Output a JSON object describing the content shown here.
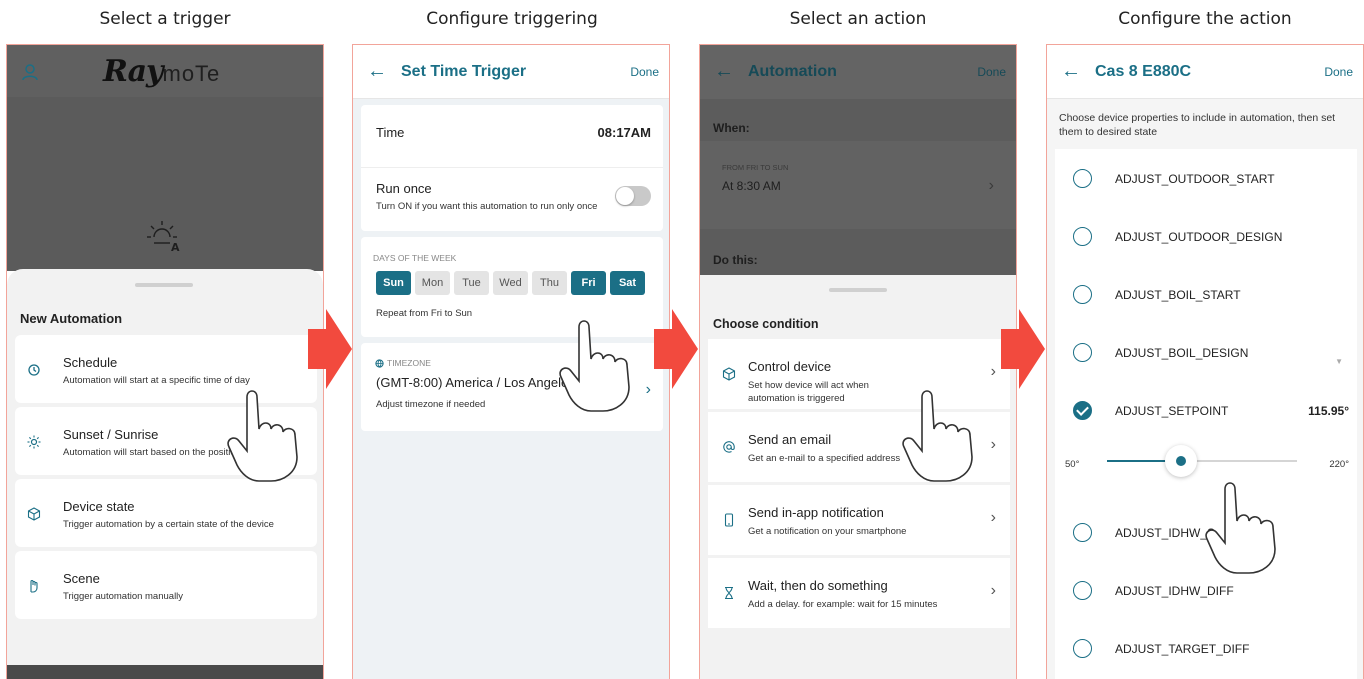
{
  "steps": {
    "s1": "Select a trigger",
    "s2": "Configure triggering",
    "s3": "Select an action",
    "s4": "Configure the action"
  },
  "colors": {
    "accent": "#1b6f86",
    "arrow": "#f24a3e",
    "frame": "#f2a49a"
  },
  "panel1": {
    "logo_main": "Ray",
    "logo_rest": "moTe",
    "sheet_title": "New Automation",
    "options": [
      {
        "label": "Schedule",
        "desc": "Automation will start at a specific time of day",
        "icon": "clock-icon"
      },
      {
        "label": "Sunset / Sunrise",
        "desc": "Automation will start based on the position",
        "icon": "sun-icon"
      },
      {
        "label": "Device state",
        "desc": "Trigger automation by a certain state of the device",
        "icon": "cube-icon"
      },
      {
        "label": "Scene",
        "desc": "Trigger automation manually",
        "icon": "hand-icon"
      }
    ]
  },
  "panel2": {
    "title": "Set Time Trigger",
    "done": "Done",
    "time_label": "Time",
    "time_value": "08:17AM",
    "run_once_label": "Run once",
    "run_once_desc": "Turn ON if you want this automation to run only once",
    "run_once_on": false,
    "days_heading": "DAYS OF THE WEEK",
    "days": [
      {
        "label": "Sun",
        "on": true
      },
      {
        "label": "Mon",
        "on": false
      },
      {
        "label": "Tue",
        "on": false
      },
      {
        "label": "Wed",
        "on": false
      },
      {
        "label": "Thu",
        "on": false
      },
      {
        "label": "Fri",
        "on": true
      },
      {
        "label": "Sat",
        "on": true
      }
    ],
    "repeat_text": "Repeat from Fri to Sun",
    "timezone_heading": "TIMEZONE",
    "timezone_value": "(GMT-8:00) America / Los Angeles",
    "timezone_hint": "Adjust timezone if needed"
  },
  "panel3": {
    "title": "Automation",
    "done": "Done",
    "when_label": "When:",
    "when_sub": "FROM FRI TO SUN",
    "when_time": "At 8:30 AM",
    "do_label": "Do this:",
    "sheet_title": "Choose condition",
    "options": [
      {
        "label": "Control device",
        "desc1": "Set how device will act when",
        "desc2": "automation is triggered",
        "icon": "cube-icon"
      },
      {
        "label": "Send an email",
        "desc1": "Get an e-mail to a specified address",
        "desc2": "",
        "icon": "at-icon"
      },
      {
        "label": "Send in-app notification",
        "desc1": "Get a notification on your smartphone",
        "desc2": "",
        "icon": "phone-icon"
      },
      {
        "label": "Wait, then do something",
        "desc1": "Add a delay. for example: wait for 15 minutes",
        "desc2": "",
        "icon": "hourglass-icon"
      }
    ]
  },
  "panel4": {
    "title": "Cas 8 E880C",
    "done": "Done",
    "intro": "Choose device properties to include in automation, then set them to desired state",
    "props": [
      {
        "label": "ADJUST_OUTDOOR_START",
        "checked": false
      },
      {
        "label": "ADJUST_OUTDOOR_DESIGN",
        "checked": false
      },
      {
        "label": "ADJUST_BOIL_START",
        "checked": false
      },
      {
        "label": "ADJUST_BOIL_DESIGN",
        "checked": false
      },
      {
        "label": "ADJUST_SETPOINT",
        "checked": true
      },
      {
        "label": "ADJUST_IDHW_S",
        "checked": false
      },
      {
        "label": "ADJUST_IDHW_DIFF",
        "checked": false
      },
      {
        "label": "ADJUST_TARGET_DIFF",
        "checked": false
      }
    ],
    "setpoint_value": "115.95°",
    "slider_min": "50°",
    "slider_max": "220°",
    "slider_fraction": 0.39
  }
}
